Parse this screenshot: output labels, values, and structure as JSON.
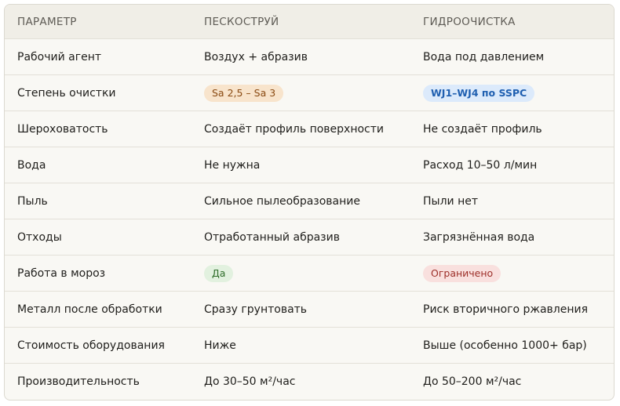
{
  "header": {
    "col1": "ПАРАМЕТР",
    "col2": "ПЕСКОСТРУЙ",
    "col3": "ГИДРООЧИСТКА"
  },
  "rows": [
    {
      "param": "Рабочий агент",
      "sand": "Воздух + абразив",
      "hydro": "Вода под давлением"
    },
    {
      "param": "Степень очистки",
      "sand": "Sa 2,5 – Sa 3",
      "hydro": "WJ1–WJ4 по SSPC"
    },
    {
      "param": "Шероховатость",
      "sand": "Создаёт профиль поверхности",
      "hydro": "Не создаёт профиль"
    },
    {
      "param": "Вода",
      "sand": "Не нужна",
      "hydro": "Расход 10–50 л/мин"
    },
    {
      "param": "Пыль",
      "sand": "Сильное пылеобразование",
      "hydro": "Пыли нет"
    },
    {
      "param": "Отходы",
      "sand": "Отработанный абразив",
      "hydro": "Загрязнённая вода"
    },
    {
      "param": "Работа в мороз",
      "sand": "Да",
      "hydro": "Ограничено"
    },
    {
      "param": "Металл после обработки",
      "sand": "Сразу грунтовать",
      "hydro": "Риск вторичного ржавления"
    },
    {
      "param": "Стоимость оборудования",
      "sand": "Ниже",
      "hydro": "Выше (особенно 1000+ бар)"
    },
    {
      "param": "Производительность",
      "sand": "До 30–50 м²/час",
      "hydro": "До 50–200 м²/час"
    }
  ],
  "colors": {
    "badge_orange_bg": "#f8e4cc",
    "badge_blue_bg": "#dceafb",
    "badge_green_bg": "#e2f1df",
    "badge_red_bg": "#f9e0de"
  }
}
